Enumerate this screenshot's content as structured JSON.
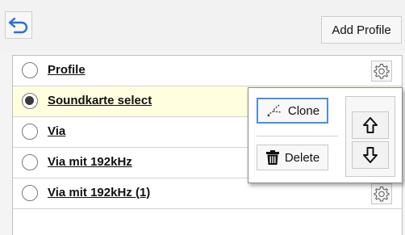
{
  "toolbar": {
    "back_icon": "undo-back-icon",
    "add_profile_label": "Add Profile"
  },
  "profiles": [
    {
      "label": "Profile",
      "selected": false,
      "has_settings": true
    },
    {
      "label": "Soundkarte select",
      "selected": true,
      "has_settings": false
    },
    {
      "label": "Via",
      "selected": false,
      "has_settings": false
    },
    {
      "label": "Via mit 192kHz",
      "selected": false,
      "has_settings": false
    },
    {
      "label": "Via mit 192kHz (1)",
      "selected": false,
      "has_settings": true
    }
  ],
  "popup": {
    "clone_label": "Clone",
    "delete_label": "Delete",
    "clone_icon": "clone-icon",
    "delete_icon": "trash-icon",
    "move_up_icon": "arrow-up-icon",
    "move_down_icon": "arrow-down-icon"
  },
  "colors": {
    "selected_row": "#ffffe0",
    "focus_border": "#4a90d9"
  }
}
